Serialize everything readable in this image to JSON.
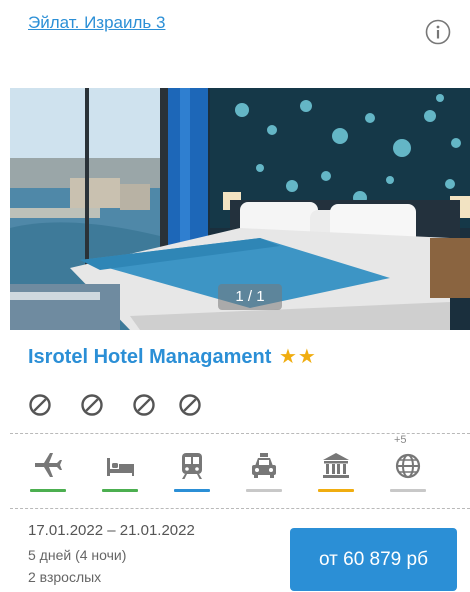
{
  "location_link": "Эйлат. Израиль 3",
  "photo": {
    "counter": "1 / 1"
  },
  "hotel": {
    "name": "Isrotel Hotel Managament",
    "stars": "★★",
    "star_count": 2
  },
  "amenities": [
    "no-icon",
    "no-icon",
    "no-icon",
    "no-icon"
  ],
  "services": [
    {
      "icon": "plane-icon",
      "bar_color": "#4caf50"
    },
    {
      "icon": "bed-icon",
      "bar_color": "#4caf50"
    },
    {
      "icon": "train-icon",
      "bar_color": "#2b8fd6"
    },
    {
      "icon": "taxi-icon",
      "bar_color": "#c8c8c8"
    },
    {
      "icon": "museum-icon",
      "bar_color": "#f0ad10"
    },
    {
      "icon": "globe-icon",
      "bar_color": "#c8c8c8"
    }
  ],
  "services_more": "+5",
  "trip": {
    "dates": "17.01.2022 – 21.01.2022",
    "duration": "5 дней (4 ночи)",
    "guests": "2 взрослых"
  },
  "price_button": "от 60 879 рб",
  "colors": {
    "accent": "#2b8fd6",
    "star": "#f0ad10",
    "green": "#4caf50"
  }
}
